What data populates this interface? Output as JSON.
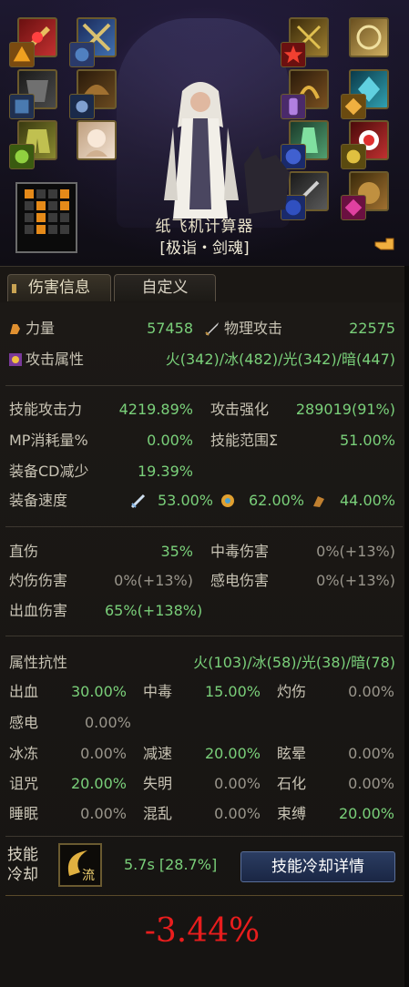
{
  "header": {
    "title": "纸飞机计算器",
    "subtitle": "[极诣・剑魂]",
    "grid_on": [
      1,
      0,
      0,
      1,
      0,
      1,
      0,
      1,
      0,
      1,
      0,
      0,
      0,
      1,
      0,
      0
    ]
  },
  "tabs": [
    {
      "label": "伤害信息",
      "active": true
    },
    {
      "label": "自定义",
      "active": false
    }
  ],
  "stats": {
    "strength_label": "力量",
    "strength_value": "57458",
    "phys_atk_label": "物理攻击",
    "phys_atk_value": "22575",
    "elem_label": "攻击属性",
    "elem_value": "火(342)/冰(482)/光(342)/暗(447)"
  },
  "skill_stats": {
    "skill_atk_label": "技能攻击力",
    "skill_atk_value": "4219.89%",
    "atk_boost_label": "攻击强化",
    "atk_boost_value": "289019(91%)",
    "mp_label": "MP消耗量%",
    "mp_value": "0.00%",
    "range_label": "技能范围Σ",
    "range_value": "51.00%",
    "cd_reduce_label": "装备CD减少",
    "cd_reduce_value": "19.39%",
    "speed_label": "装备速度",
    "speed_1": "53.00%",
    "speed_2": "62.00%",
    "speed_3": "44.00%"
  },
  "damage": {
    "direct_label": "直伤",
    "direct_value": "35%",
    "poison_label": "中毒伤害",
    "poison_value": "0%(+13%)",
    "burn_label": "灼伤伤害",
    "burn_value": "0%(+13%)",
    "shock_label": "感电伤害",
    "shock_value": "0%(+13%)",
    "bleed_label": "出血伤害",
    "bleed_value": "65%(+138%)"
  },
  "resist": {
    "label": "属性抗性",
    "value": "火(103)/冰(58)/光(38)/暗(78)",
    "rows": [
      [
        {
          "l": "出血",
          "v": "30.00%",
          "g": true
        },
        {
          "l": "中毒",
          "v": "15.00%",
          "g": true
        },
        {
          "l": "灼伤",
          "v": "0.00%",
          "g": false
        }
      ],
      [
        {
          "l": "感电",
          "v": "0.00%",
          "g": false
        }
      ],
      [
        {
          "l": "冰冻",
          "v": "0.00%",
          "g": false
        },
        {
          "l": "减速",
          "v": "20.00%",
          "g": true
        },
        {
          "l": "眩晕",
          "v": "0.00%",
          "g": false
        }
      ],
      [
        {
          "l": "诅咒",
          "v": "20.00%",
          "g": true
        },
        {
          "l": "失明",
          "v": "0.00%",
          "g": false
        },
        {
          "l": "石化",
          "v": "0.00%",
          "g": false
        }
      ],
      [
        {
          "l": "睡眠",
          "v": "0.00%",
          "g": false
        },
        {
          "l": "混乱",
          "v": "0.00%",
          "g": false
        },
        {
          "l": "束缚",
          "v": "20.00%",
          "g": true
        }
      ]
    ]
  },
  "cooldown": {
    "label_1": "技能",
    "label_2": "冷却",
    "skill_glyph": "流",
    "value": "5.7s [28.7%]",
    "button": "技能冷却详情"
  },
  "result": "-3.44%"
}
